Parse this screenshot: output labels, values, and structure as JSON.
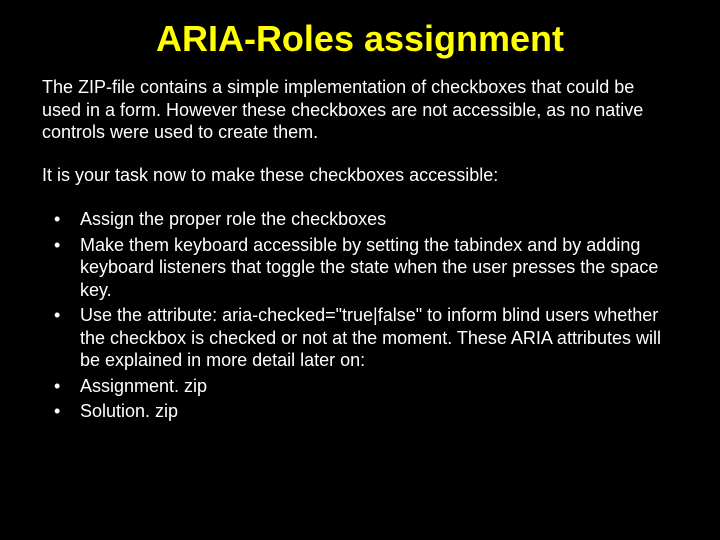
{
  "title": "ARIA-Roles assignment",
  "intro": "The ZIP-file contains a simple implementation of checkboxes that could be used in a form. However these checkboxes are not accessible, as no native controls were used to create them.",
  "task": "It is your task now to make these checkboxes accessible:",
  "bullets": [
    "Assign the proper role the checkboxes",
    "Make them keyboard accessible by setting the tabindex and by adding keyboard listeners that toggle the state when the user presses the space key.",
    "Use the attribute: aria-checked=\"true|false\"  to inform blind users whether the checkbox is checked or not at the moment. These ARIA attributes will be explained in more detail later on:",
    "Assignment. zip",
    "Solution. zip"
  ]
}
